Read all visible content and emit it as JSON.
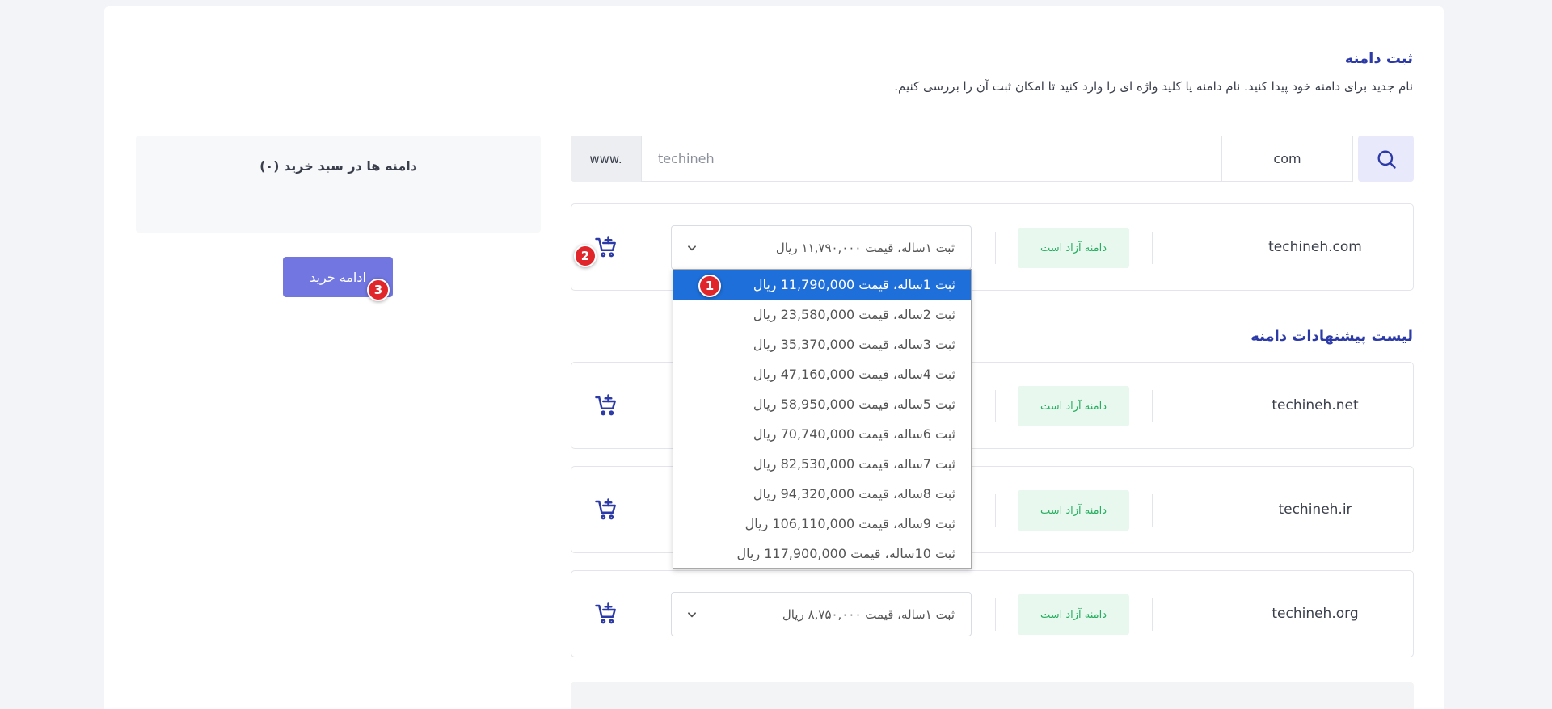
{
  "header": {
    "title": "ثبت دامنه",
    "subtitle": "نام جدید برای دامنه خود پیدا کنید. نام دامنه یا کلید واژه ای را وارد کنید تا امکان ثبت آن را بررسی کنیم."
  },
  "search": {
    "prefix": "www.",
    "placeholder": "techineh",
    "tld": "com",
    "icon": "search-icon"
  },
  "main_result": {
    "domain": "techineh.com",
    "status": "دامنه آزاد است",
    "selected_period": "ثبت ۱ساله، قیمت ۱۱,۷۹۰,۰۰۰ ریال"
  },
  "dropdown_options": [
    "ثبت 1ساله، قیمت 11,790,000 ریال",
    "ثبت 2ساله، قیمت 23,580,000 ریال",
    "ثبت 3ساله، قیمت 35,370,000 ریال",
    "ثبت 4ساله، قیمت 47,160,000 ریال",
    "ثبت 5ساله، قیمت 58,950,000 ریال",
    "ثبت 6ساله، قیمت 70,740,000 ریال",
    "ثبت 7ساله، قیمت 82,530,000 ریال",
    "ثبت 8ساله، قیمت 94,320,000 ریال",
    "ثبت 9ساله، قیمت 106,110,000 ریال",
    "ثبت 10ساله، قیمت 117,900,000 ریال"
  ],
  "suggestions": {
    "title": "لیست پیشنهادات دامنه",
    "items": [
      {
        "domain": "techineh.net",
        "status": "دامنه آزاد است"
      },
      {
        "domain": "techineh.ir",
        "status": "دامنه آزاد است"
      },
      {
        "domain": "techineh.org",
        "status": "دامنه آزاد است",
        "selected_period": "ثبت ۱ساله، قیمت ۸,۷۵۰,۰۰۰ ریال"
      }
    ]
  },
  "cart": {
    "title": "دامنه ها در سبد خرید (۰)",
    "continue_label": "ادامه خرید"
  },
  "markers": [
    "1",
    "2",
    "3"
  ],
  "colors": {
    "accent": "#2c3aa8",
    "button": "#7176e0",
    "badge_bg": "#e8f8ef",
    "badge_text": "#27ae60",
    "selected_option": "#1e6fd9",
    "marker": "#e0262b"
  }
}
